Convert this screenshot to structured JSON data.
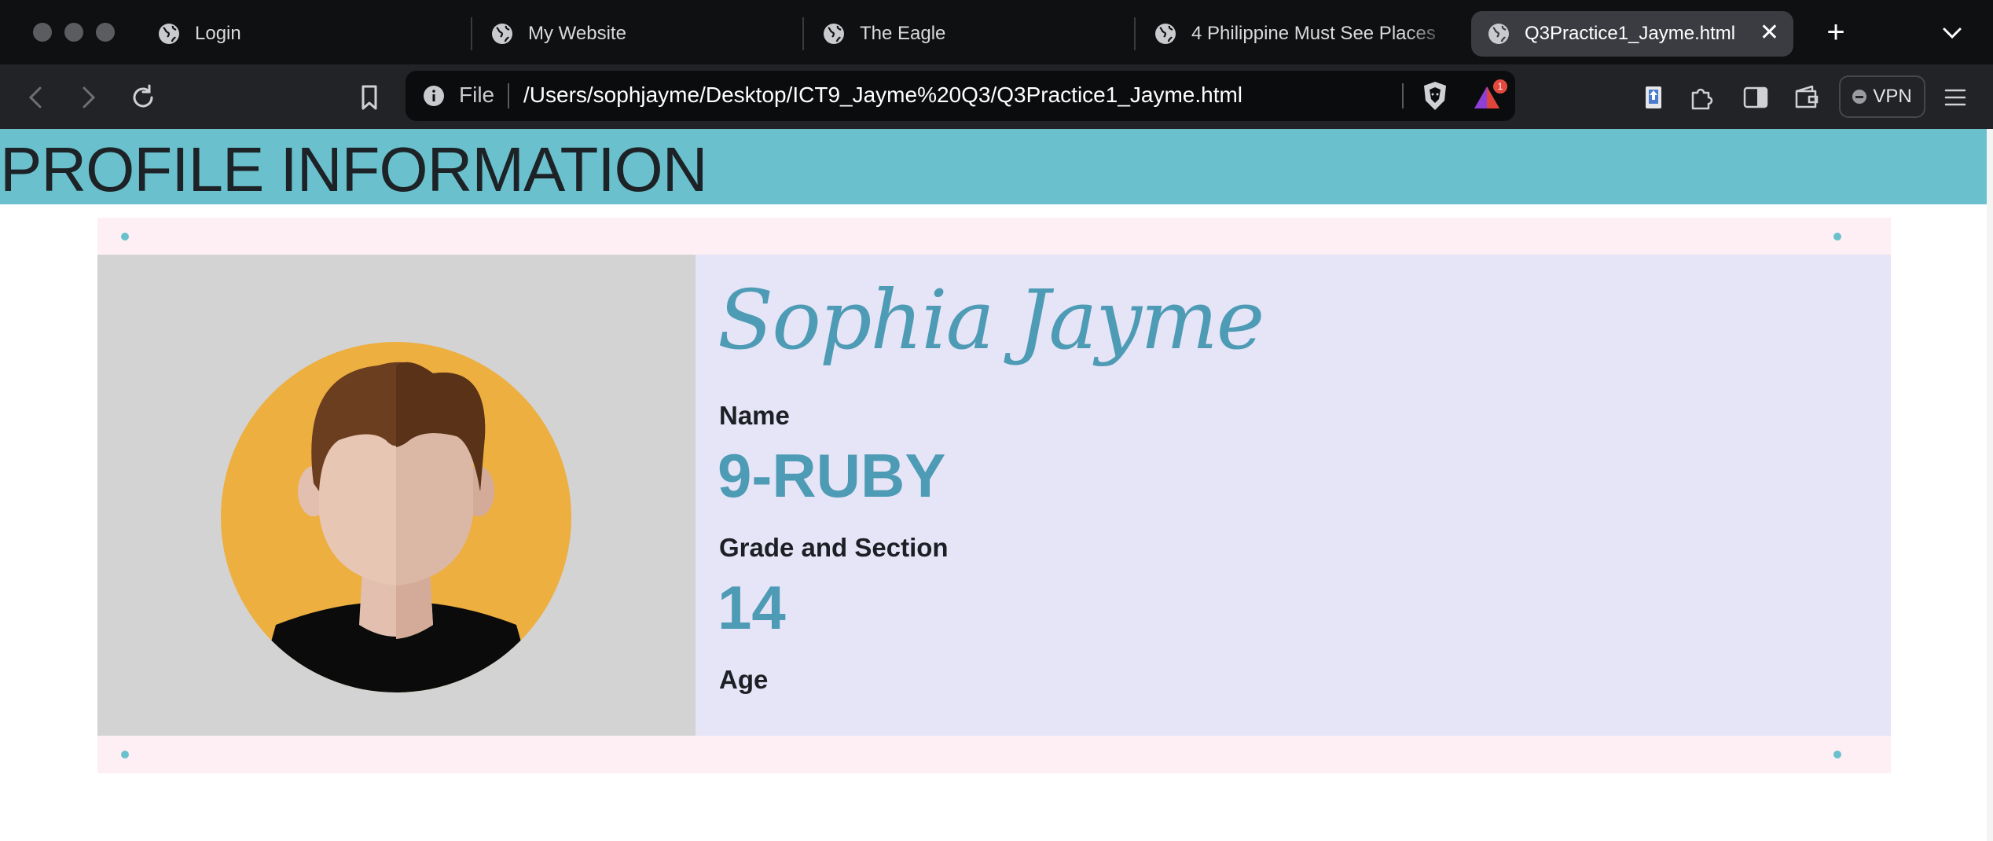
{
  "browser": {
    "tabs": [
      {
        "title": "Login",
        "active": false
      },
      {
        "title": "My Website",
        "active": false
      },
      {
        "title": "The Eagle",
        "active": false
      },
      {
        "title": "4 Philippine Must See Places",
        "active": false
      },
      {
        "title": "Q3Practice1_Jayme.html",
        "active": true
      }
    ],
    "new_tab_symbol": "+",
    "close_symbol": "✕",
    "address": {
      "scheme_label": "File",
      "url": "/Users/sophjayme/Desktop/ICT9_Jayme%20Q3/Q3Practice1_Jayme.html"
    },
    "rewards_badge": "1",
    "vpn_label": "VPN",
    "icons": [
      "back-icon",
      "forward-icon",
      "reload-icon",
      "bookmark-icon",
      "info-icon",
      "brave-shield-icon",
      "brave-rewards-icon",
      "extension-app-icon",
      "extensions-puzzle-icon",
      "sidebar-icon",
      "wallet-icon",
      "menu-icon"
    ]
  },
  "page": {
    "header_title": "PROFILE INFORMATION",
    "profile": {
      "display_name": "Sophia Jayme",
      "fields": [
        {
          "value": "",
          "label": "Name"
        },
        {
          "value": "9-RUBY",
          "label": "Grade and Section"
        },
        {
          "value": "14",
          "label": "Age"
        }
      ]
    },
    "colors": {
      "header_bg": "#6ac1cd",
      "accent_text": "#4e9bb5",
      "info_bg": "#e6e4f7",
      "photo_bg": "#d3d3d3",
      "band_bg": "#fdeff3",
      "avatar_circle": "#edaf40"
    }
  }
}
